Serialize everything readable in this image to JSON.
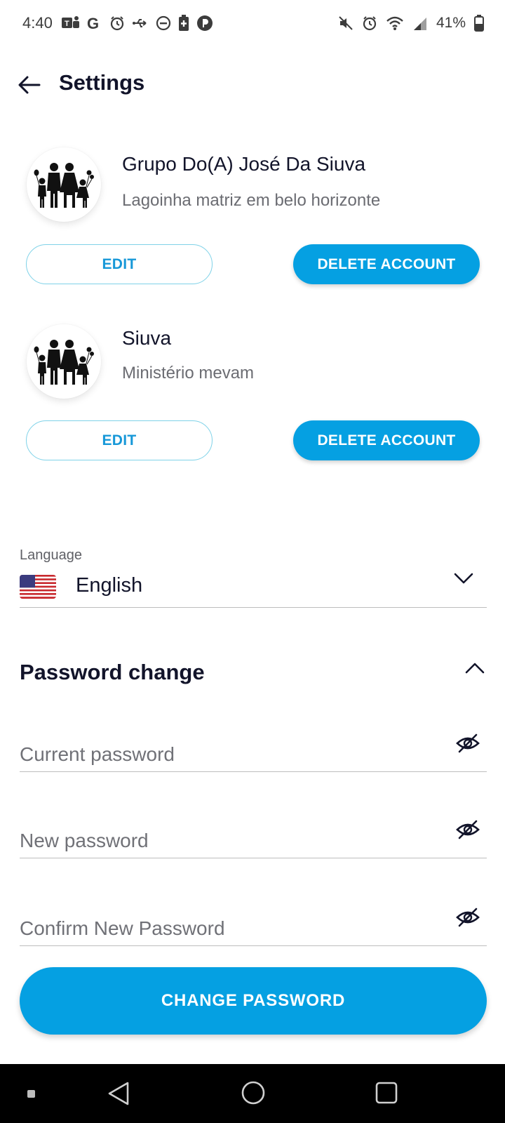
{
  "status_bar": {
    "time": "4:40",
    "battery": "41%",
    "left_icons": [
      "teams-icon",
      "google-icon",
      "alarm-icon",
      "usb-icon",
      "dnd-icon",
      "battery-saver-icon",
      "app-p-icon"
    ],
    "right_icons": [
      "mute-icon",
      "alarm-icon",
      "wifi-icon",
      "signal-icon",
      "battery-icon"
    ]
  },
  "header": {
    "title": "Settings",
    "back_icon": "arrow-left-icon"
  },
  "accounts": [
    {
      "name": "Grupo Do(A) José Da Siuva",
      "subtitle": "Lagoinha matriz em belo horizonte",
      "avatar_icon": "family-icon",
      "edit_label": "EDIT",
      "delete_label": "DELETE ACCOUNT"
    },
    {
      "name": "Siuva",
      "subtitle": "Ministério mevam",
      "avatar_icon": "family-icon",
      "edit_label": "EDIT",
      "delete_label": "DELETE ACCOUNT"
    }
  ],
  "language": {
    "label": "Language",
    "value": "English",
    "flag_icon": "us-flag-icon"
  },
  "password": {
    "title": "Password change",
    "current_placeholder": "Current password",
    "new_placeholder": "New password",
    "confirm_placeholder": "Confirm New Password",
    "submit_label": "CHANGE PASSWORD"
  },
  "colors": {
    "accent": "#05a0e2",
    "edit_border": "#7fd2e8",
    "title_text": "#12142a",
    "subtitle_text": "#6b6c72"
  }
}
